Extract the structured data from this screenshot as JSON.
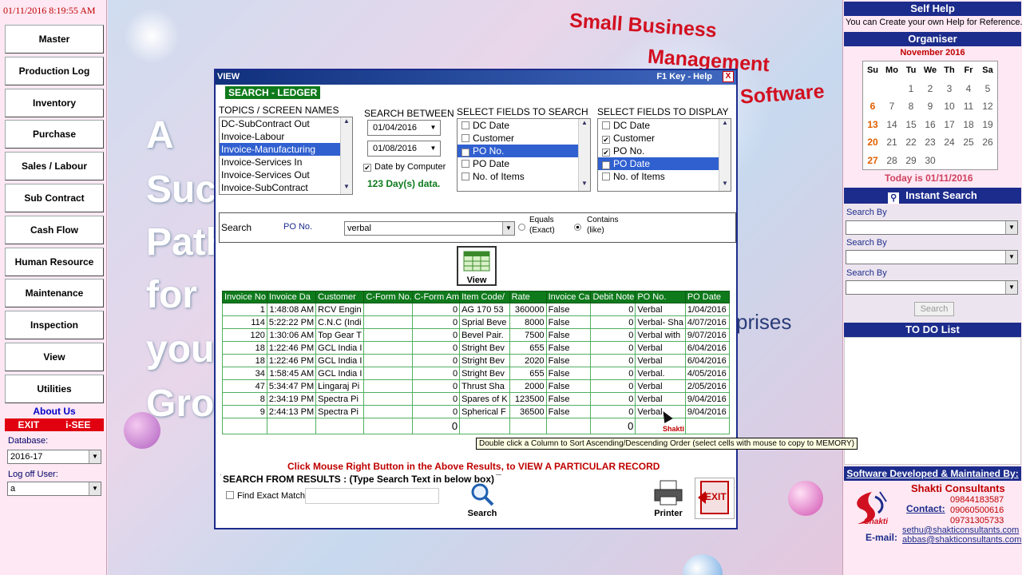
{
  "datetime": "01/11/2016   8:19:55 AM",
  "menu": [
    "Master",
    "Production Log",
    "Inventory",
    "Purchase",
    "Sales / Labour",
    "Sub Contract",
    "Cash Flow",
    "Human Resource",
    "Maintenance",
    "Inspection",
    "View",
    "Utilities"
  ],
  "about_us": "About  Us",
  "exit_label": "EXIT",
  "isee_label": "i-SEE",
  "database_label": "Database:",
  "database_value": "2016-17",
  "logoff_label": "Log off User:",
  "logoff_value": "a",
  "background": {
    "words": [
      "A",
      "Succ",
      "Path",
      "for",
      "your",
      "Grow"
    ],
    "logo_line1": "Small Business",
    "logo_line2": "Management",
    "logo_line3": "Software",
    "prises": "prises"
  },
  "right": {
    "selfhelp_title": "Self Help",
    "selfhelp_text": "You can Create your own Help for Reference.",
    "organiser_title": "Organiser",
    "calendar_month": "November 2016",
    "calendar_days": [
      "Su",
      "Mo",
      "Tu",
      "We",
      "Th",
      "Fr",
      "Sa"
    ],
    "calendar_weeks": [
      [
        "",
        "",
        "1",
        "2",
        "3",
        "4",
        "5"
      ],
      [
        "6",
        "7",
        "8",
        "9",
        "10",
        "11",
        "12"
      ],
      [
        "13",
        "14",
        "15",
        "16",
        "17",
        "18",
        "19"
      ],
      [
        "20",
        "21",
        "22",
        "23",
        "24",
        "25",
        "26"
      ],
      [
        "27",
        "28",
        "29",
        "30",
        "",
        "",
        ""
      ]
    ],
    "today_text": "Today  is  01/11/2016",
    "instant_title": "Instant Search",
    "search_by": "Search By",
    "search_button": "Search",
    "todo_title": "TO DO  List",
    "dev_title": "Software Developed & Maintained By:",
    "company": "Shakti Consultants",
    "contact_label": "Contact:",
    "phones": [
      "09844183587",
      "09060500616",
      "09731305733"
    ],
    "email_label": "E-mail:",
    "emails": [
      "sethu@shakticonsultants.com",
      "abbas@shakticonsultants.com"
    ],
    "logo_word": "Shakti"
  },
  "dialog": {
    "title": "VIEW",
    "help": "F1 Key - Help",
    "close": "X",
    "ledger_title": "SEARCH - LEDGER",
    "topics_label": "TOPICS / SCREEN NAMES",
    "topics": [
      "DC-SubContract Out",
      "Invoice-Labour",
      "Invoice-Manufacturing",
      "Invoice-Services In",
      "Invoice-Services Out",
      "Invoice-SubContract"
    ],
    "topics_selected": 2,
    "between_label": "SEARCH  BETWEEN",
    "date_from": "01/04/2016",
    "date_to": "01/08/2016",
    "date_by_computer": "Date by Computer",
    "days_data": "123 Day(s) data.",
    "search_fields_label": "SELECT FIELDS TO SEARCH",
    "search_fields": [
      {
        "label": "DC Date",
        "checked": false,
        "sel": false
      },
      {
        "label": "Customer",
        "checked": false,
        "sel": false
      },
      {
        "label": "PO No.",
        "checked": true,
        "sel": true
      },
      {
        "label": "PO Date",
        "checked": false,
        "sel": false
      },
      {
        "label": "No. of Items",
        "checked": false,
        "sel": false
      }
    ],
    "display_fields_label": "SELECT FIELDS TO DISPLAY",
    "display_fields": [
      {
        "label": "DC Date",
        "checked": false,
        "sel": false
      },
      {
        "label": "Customer",
        "checked": true,
        "sel": false
      },
      {
        "label": "PO No.",
        "checked": true,
        "sel": false
      },
      {
        "label": "PO Date",
        "checked": true,
        "sel": true
      },
      {
        "label": "No. of Items",
        "checked": false,
        "sel": false
      }
    ],
    "search_label": "Search",
    "search_field_name": "PO No.",
    "search_value": "verbal",
    "equals_label": "Equals",
    "exact_label": "(Exact)",
    "contains_label": "Contains",
    "like_label": "(like)",
    "view_button": "View",
    "columns": [
      "Invoice No",
      "Invoice Da",
      "Customer",
      "C-Form No.",
      "C-Form Am",
      "Item Code/",
      "Rate",
      "Invoice Ca",
      "Debit Note",
      "PO No.",
      "PO Date"
    ],
    "rows": [
      [
        "1",
        "1:48:08 AM",
        "RCV Engin",
        "",
        "0",
        "AG 170 53",
        "360000",
        "False",
        "0",
        "Verbal",
        "1/04/2016"
      ],
      [
        "114",
        "5:22:22 PM",
        "C.N.C (Indi",
        "",
        "0",
        "Sprial Beve",
        "8000",
        "False",
        "0",
        "Verbal- Sha",
        "4/07/2016"
      ],
      [
        "120",
        "1:30:06 AM",
        "Top Gear T",
        "",
        "0",
        "Bevel Pair.",
        "7500",
        "False",
        "0",
        "Verbal with",
        "9/07/2016"
      ],
      [
        "18",
        "1:22:46 PM",
        "GCL India I",
        "",
        "0",
        "Stright Bev",
        "655",
        "False",
        "0",
        "Verbal",
        "6/04/2016"
      ],
      [
        "18",
        "1:22:46 PM",
        "GCL India I",
        "",
        "0",
        "Stright Bev",
        "2020",
        "False",
        "0",
        "Verbal",
        "6/04/2016"
      ],
      [
        "34",
        "1:58:45 AM",
        "GCL India I",
        "",
        "0",
        "Stright Bev",
        "655",
        "False",
        "0",
        "Verbal.",
        "4/05/2016"
      ],
      [
        "47",
        "5:34:47 PM",
        "Lingaraj Pi",
        "",
        "0",
        "Thrust Sha",
        "2000",
        "False",
        "0",
        "Verbal",
        "2/05/2016"
      ],
      [
        "8",
        "2:34:19 PM",
        "Spectra Pi",
        "",
        "0",
        "Spares of K",
        "123500",
        "False",
        "0",
        "Verbal",
        "9/04/2016"
      ],
      [
        "9",
        "2:44:13 PM",
        "Spectra Pi",
        "",
        "0",
        "Spherical F",
        "36500",
        "False",
        "0",
        "Verbal",
        "9/04/2016"
      ]
    ],
    "totals": [
      "",
      "",
      "",
      "",
      "0",
      "",
      "",
      "",
      "0",
      "",
      ""
    ],
    "tooltip": "Double click a Column to Sort Ascending/Descending Order  (select cells with mouse to copy to MEMORY)",
    "shakti_cursor": "Shakti",
    "click_msg": "Click Mouse Right Button in the Above Results,  to VIEW A PARTICULAR RECORD",
    "sfr_title": "SEARCH FROM RESULTS : (Type Search Text in  below box)",
    "find_exact": "Find Exact Match",
    "search_btn": "Search",
    "printer_btn": "Printer",
    "exit_btn": "EXIT"
  },
  "colors": {
    "header_blue": "#1c2c8c",
    "grid_green": "#0f7a1c",
    "exit_red": "#e00010"
  }
}
